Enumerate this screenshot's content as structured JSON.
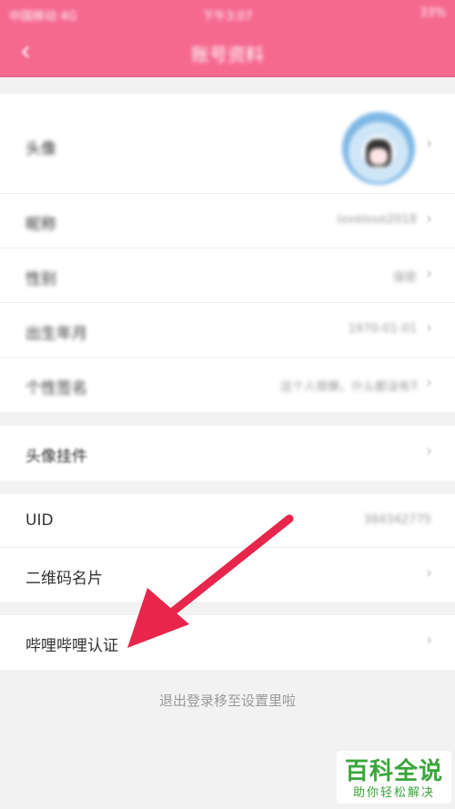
{
  "status_bar": {
    "carrier": "中国移动 4G",
    "time": "下午3:07",
    "battery": "33%"
  },
  "nav": {
    "back_icon": "chevron-left-icon",
    "title": "账号资料"
  },
  "profile": {
    "avatar_label": "头像",
    "nickname_label": "昵称",
    "nickname_value": "lovelove2018",
    "gender_label": "性别",
    "gender_value": "保密",
    "birthday_label": "出生年月",
    "birthday_value": "1970-01-01",
    "signature_label": "个性签名",
    "signature_value": "这个人很懒，什么都没有写"
  },
  "pendant": {
    "label": "头像挂件"
  },
  "account": {
    "uid_label": "UID",
    "uid_value": "384342775",
    "qrcode_label": "二维码名片"
  },
  "cert": {
    "label": "哔哩哔哩认证"
  },
  "footer": {
    "text": "退出登录移至设置里啦"
  },
  "watermark": {
    "title": "百科全说",
    "subtitle": "助你轻松解决"
  },
  "colors": {
    "brand": "#f5698f",
    "arrow": "#e8254a",
    "watermark": "#3aa63a"
  }
}
